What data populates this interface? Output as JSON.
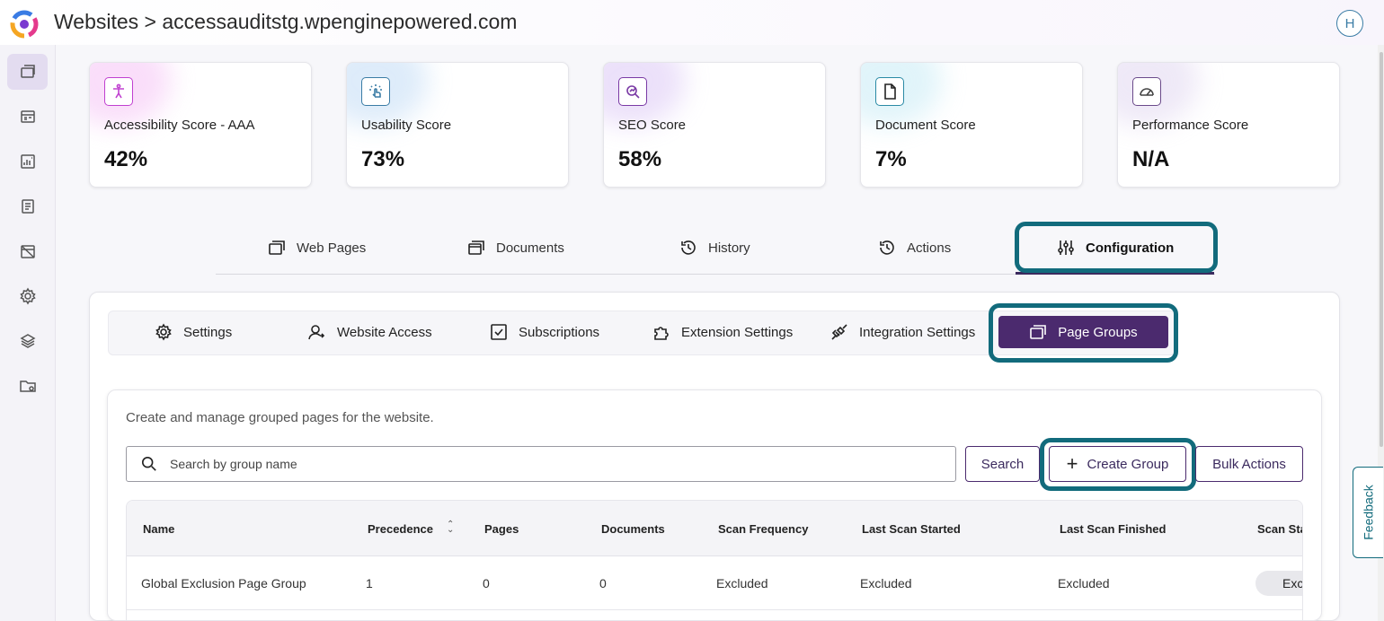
{
  "header": {
    "title": "Websites > accessauditstg.wpenginepowered.com",
    "avatar_letter": "H"
  },
  "sidebar": {
    "items": [
      {
        "icon": "websites-icon",
        "active": true
      },
      {
        "icon": "dashboard-icon"
      },
      {
        "icon": "reports-icon"
      },
      {
        "icon": "document-icon"
      },
      {
        "icon": "calendar-off-icon"
      },
      {
        "icon": "gear-icon"
      },
      {
        "icon": "layers-icon"
      },
      {
        "icon": "folder-settings-icon"
      }
    ]
  },
  "scores": [
    {
      "label": "Accessibility Score - AAA",
      "value": "42%",
      "icon": "accessibility-icon",
      "color": "#c040d0"
    },
    {
      "label": "Usability Score",
      "value": "73%",
      "icon": "usability-icon",
      "color": "#3a7ca5"
    },
    {
      "label": "SEO Score",
      "value": "58%",
      "icon": "seo-icon",
      "color": "#7a3aa5"
    },
    {
      "label": "Document Score",
      "value": "7%",
      "icon": "document-icon",
      "color": "#2a8aa5"
    },
    {
      "label": "Performance Score",
      "value": "N/A",
      "icon": "performance-icon",
      "color": "#6a4a8a"
    }
  ],
  "tabs": {
    "web_pages": "Web Pages",
    "documents": "Documents",
    "history": "History",
    "actions": "Actions",
    "configuration": "Configuration"
  },
  "subtabs": {
    "settings": "Settings",
    "website_access": "Website Access",
    "subscriptions": "Subscriptions",
    "extension_settings": "Extension Settings",
    "integration_settings": "Integration Settings",
    "page_groups": "Page Groups"
  },
  "page_groups": {
    "description": "Create and manage grouped pages for the website.",
    "search_placeholder": "Search by group name",
    "search_button": "Search",
    "create_button": "Create Group",
    "bulk_button": "Bulk Actions"
  },
  "table": {
    "headers": [
      "Name",
      "Precedence",
      "Pages",
      "Documents",
      "Scan Frequency",
      "Last Scan Started",
      "Last Scan Finished",
      "Scan Sta"
    ],
    "rows": [
      [
        "Global Exclusion Page Group",
        "1",
        "0",
        "0",
        "Excluded",
        "Excluded",
        "Excluded",
        "Exc"
      ]
    ]
  },
  "feedback": "Feedback",
  "colors": {
    "accent": "#4b2a6e",
    "highlight": "#126b7c"
  }
}
